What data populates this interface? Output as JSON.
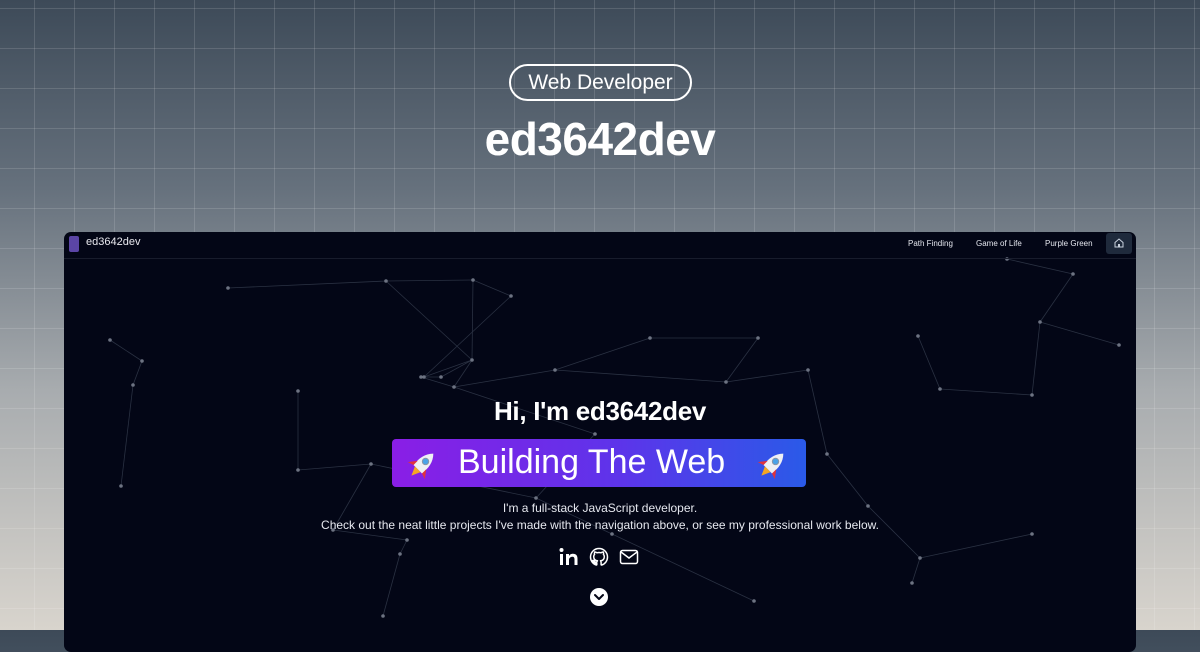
{
  "header": {
    "badge": "Web Developer",
    "title": "ed3642dev"
  },
  "site": {
    "name": "ed3642dev",
    "nav": {
      "path_finding": "Path Finding",
      "game_of_life": "Game of Life",
      "purple_green": "Purple Green"
    }
  },
  "hero": {
    "greeting": "Hi, I'm ed3642dev",
    "banner": "Building The Web",
    "intro_line1": "I'm a full-stack JavaScript developer.",
    "intro_line2": "Check out the neat little projects I've made with the navigation above, or see my professional work below."
  },
  "icons": {
    "social": [
      "linkedin-icon",
      "github-icon",
      "mail-icon"
    ],
    "banner": "rocket-icon",
    "scroll": "chevron-down-icon",
    "home": "home-icon"
  },
  "colors": {
    "window_bg": "#030616",
    "banner_gradient_start": "#8a1ee6",
    "banner_gradient_end": "#2a5ae8",
    "home_button": "#1f2a3c",
    "logo": "#5b45a6"
  }
}
